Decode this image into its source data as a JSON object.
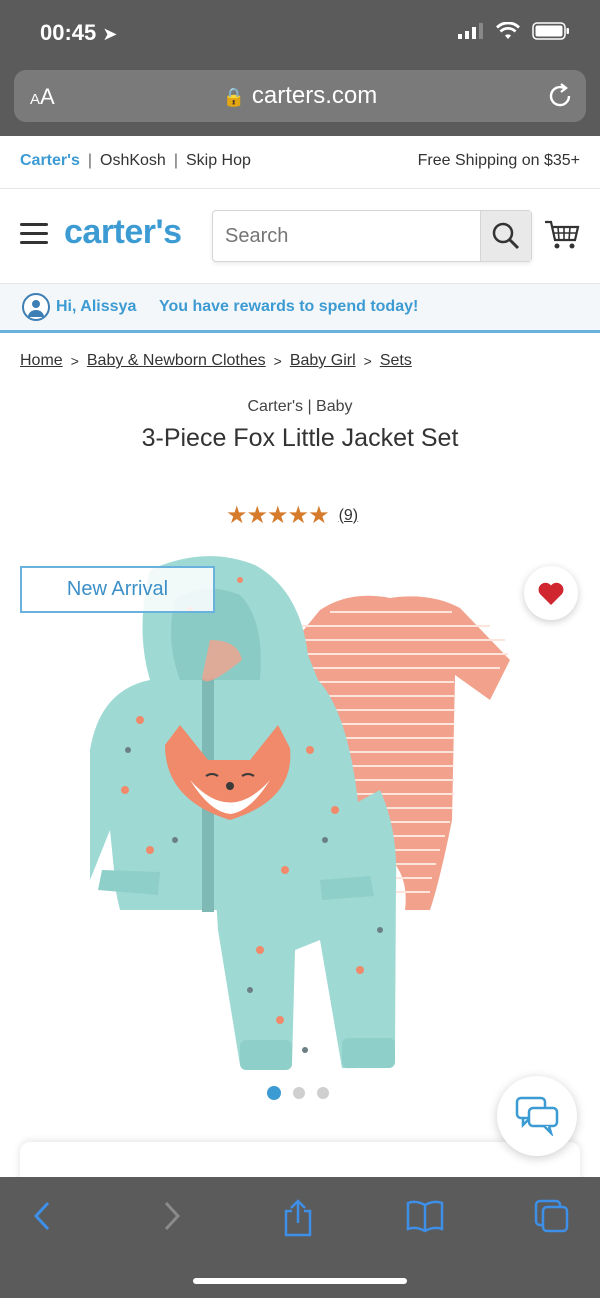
{
  "status_bar": {
    "time": "00:45"
  },
  "browser": {
    "text_size_label": "AA",
    "url": "carters.com"
  },
  "promo": {
    "brands": [
      "Carter's",
      "OshKosh",
      "Skip Hop"
    ],
    "shipping": "Free Shipping on $35+"
  },
  "header": {
    "logo": "carter's",
    "search_placeholder": "Search"
  },
  "rewards": {
    "greeting": "Hi, Alissya",
    "message": "You have rewards to spend today!"
  },
  "breadcrumbs": [
    "Home",
    "Baby & Newborn Clothes",
    "Baby Girl",
    "Sets"
  ],
  "product": {
    "brand": "Carter's | Baby",
    "title": "3-Piece Fox Little Jacket Set",
    "rating": 4.7,
    "stars_display": "★★★★★",
    "reviews": "(9)",
    "badge": "New Arrival",
    "carousel": {
      "total": 3,
      "active": 1
    }
  },
  "colors": {
    "brand_blue": "#3d9bd3",
    "star_orange": "#d67b2b",
    "heart_red": "#d0262f",
    "jacket_mint": "#9ed9d4",
    "bodysuit_coral": "#f2a28c"
  }
}
